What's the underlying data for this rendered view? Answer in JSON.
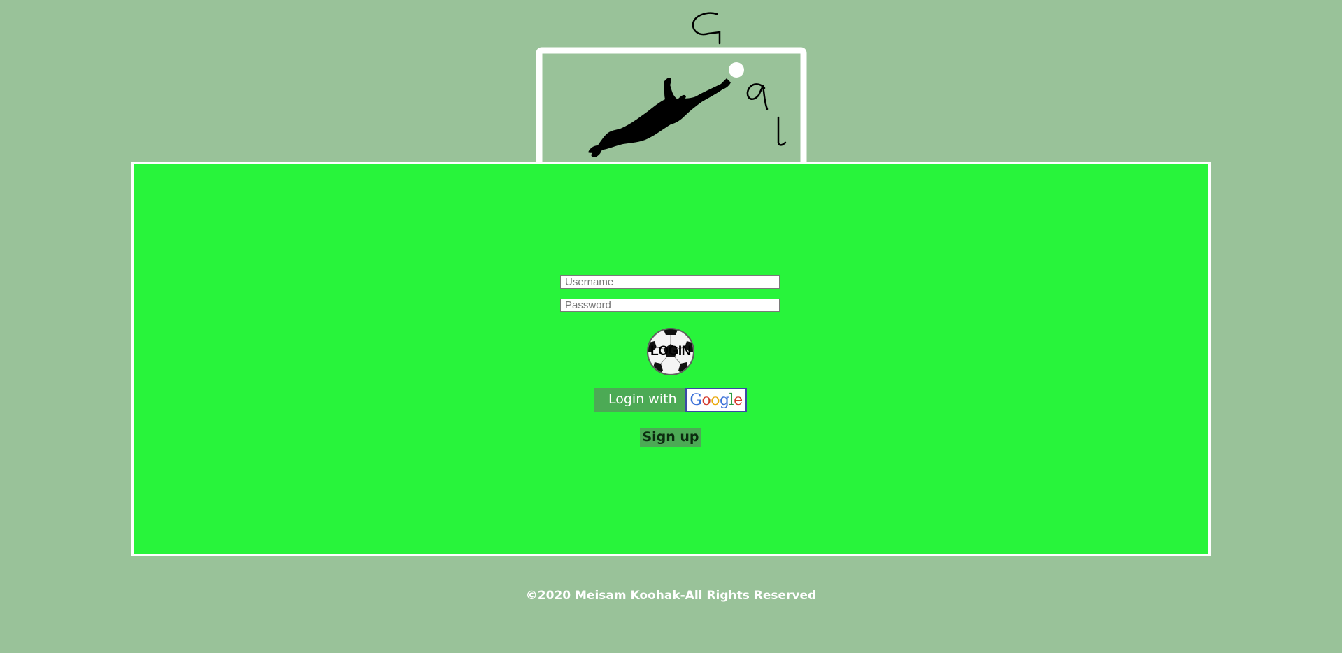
{
  "logo": {
    "letters": [
      "G",
      "a",
      "l"
    ]
  },
  "form": {
    "username_placeholder": "Username",
    "password_placeholder": "Password",
    "login_label": "LOGIN",
    "google_prefix": "Login with",
    "google_letters": [
      "G",
      "o",
      "o",
      "g",
      "l",
      "e"
    ],
    "signup_label": "Sign up"
  },
  "footer": {
    "text": "©2020 Meisam Koohak-All Rights Reserved"
  },
  "colors": {
    "background": "#99c299",
    "pitch": "#28f43b",
    "button": "#4caa55",
    "google_border": "#3b47a6"
  }
}
